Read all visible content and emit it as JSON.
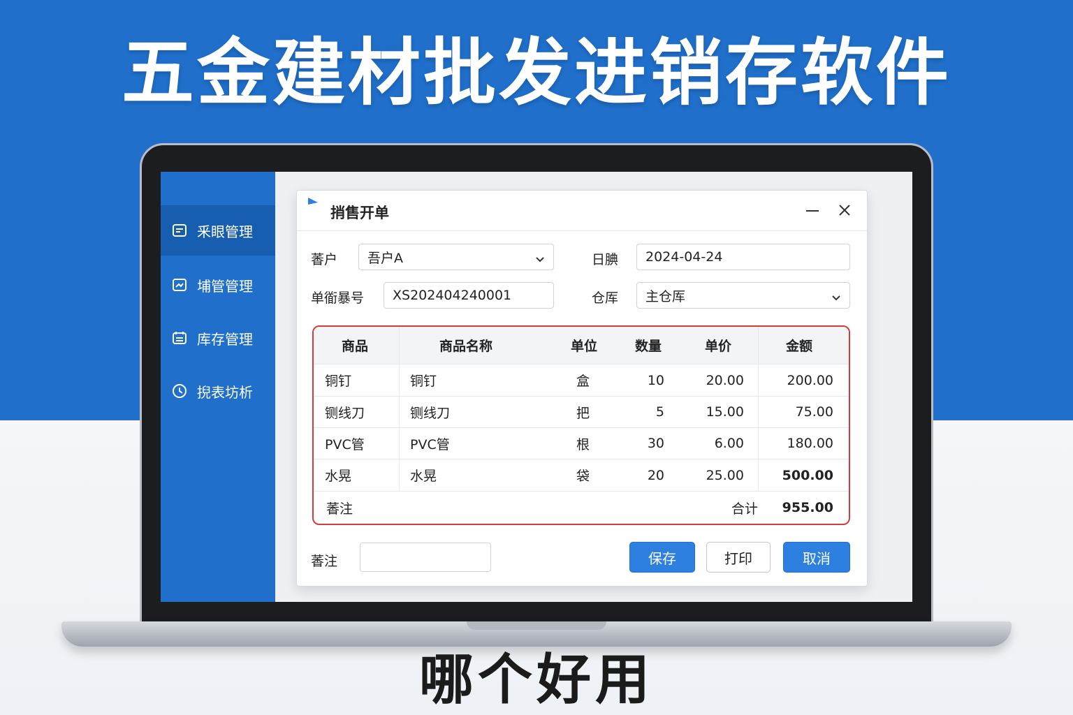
{
  "headline": "五金建材批发进销存软件",
  "subline": "哪个好用",
  "sidebar": {
    "items": [
      {
        "label": "釆眼管理",
        "icon": "purchase-icon",
        "active": true
      },
      {
        "label": "埔管管理",
        "icon": "sales-icon",
        "active": false
      },
      {
        "label": "库存管理",
        "icon": "inventory-icon",
        "active": false
      },
      {
        "label": "掜表坊析",
        "icon": "clock-icon",
        "active": false
      }
    ]
  },
  "dialog": {
    "title": "捎售开单",
    "customer_label": "萫户",
    "customer_value": "吾户A",
    "date_label": "日腆",
    "date_value": "2024-04-24",
    "order_no_label": "单衜暴号",
    "order_no_value": "XS202404240001",
    "warehouse_label": "仓厍",
    "warehouse_value": "主仓厍",
    "remark_label": "萫注",
    "remark_value": "",
    "buttons": {
      "save": "保存",
      "print": "打印",
      "cancel": "取消"
    }
  },
  "table": {
    "columns": [
      "商品",
      "商品名称",
      "单位",
      "数量",
      "单价",
      "金额"
    ],
    "rows": [
      {
        "product": "铜钉",
        "name": "铜钉",
        "unit": "盒",
        "qty": "10",
        "price": "20.00",
        "amount": "200.00"
      },
      {
        "product": "铡线刀",
        "name": "铡线刀",
        "unit": "把",
        "qty": "5",
        "price": "15.00",
        "amount": "75.00"
      },
      {
        "product": "PVC管",
        "name": "PVC管",
        "unit": "根",
        "qty": "30",
        "price": "6.00",
        "amount": "180.00"
      },
      {
        "product": "水晃",
        "name": "水晃",
        "unit": "袋",
        "qty": "20",
        "price": "25.00",
        "amount": "500.00"
      }
    ],
    "footer": {
      "remark": "萫注",
      "total_label": "合计",
      "total_value": "955.00"
    }
  },
  "colors": {
    "brand_blue": "#1f6fcb",
    "sidebar_active": "#175db0",
    "table_border": "#d23c3c",
    "primary_button": "#2d7fe0"
  }
}
